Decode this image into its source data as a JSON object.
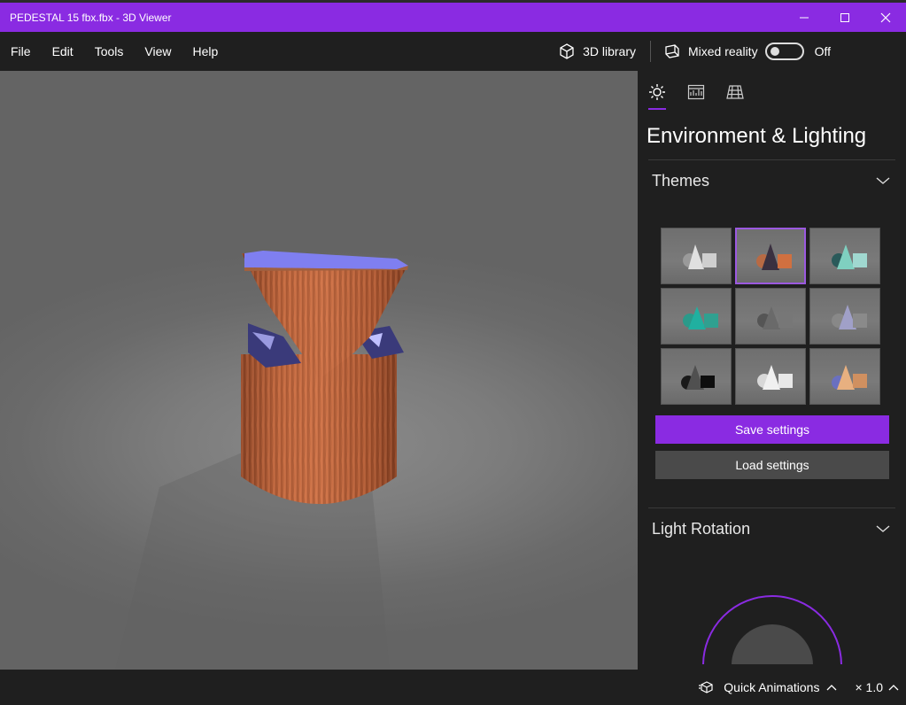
{
  "window": {
    "title": "PEDESTAL 15 fbx.fbx - 3D Viewer",
    "accent_color": "#8a2be2"
  },
  "menu": {
    "items": [
      "File",
      "Edit",
      "Tools",
      "View",
      "Help"
    ],
    "library_label": "3D library",
    "mixed_reality_label": "Mixed reality",
    "mixed_reality_state": "Off"
  },
  "panel": {
    "tabs": [
      "sun-icon",
      "stats-icon",
      "grid-icon"
    ],
    "title": "Environment & Lighting",
    "themes_label": "Themes",
    "selected_theme": 2,
    "save_label": "Save settings",
    "load_label": "Load settings",
    "light_rotation_label": "Light Rotation"
  },
  "status": {
    "animations_label": "Quick Animations",
    "speed": "× 1.0"
  }
}
